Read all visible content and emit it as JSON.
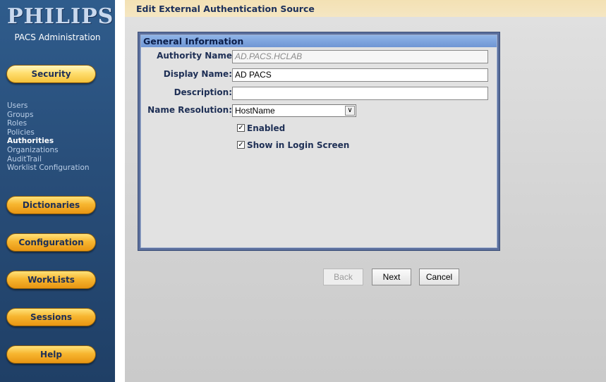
{
  "sidebar": {
    "logo": "PHILIPS",
    "app_title": "PACS Administration",
    "buttons": {
      "security": "Security",
      "dictionaries": "Dictionaries",
      "configuration": "Configuration",
      "worklists": "WorkLists",
      "sessions": "Sessions",
      "help": "Help"
    },
    "security_items": [
      "Users",
      "Groups",
      "Roles",
      "Policies",
      "Authorities",
      "Organizations",
      "AuditTrail",
      "Worklist Configuration"
    ],
    "active_item": "Authorities"
  },
  "page": {
    "title": "Edit External Authentication Source"
  },
  "form": {
    "section_title": "General Information",
    "authority_name_label": "Authority Name",
    "authority_name_value": "AD.PACS.HCLAB",
    "display_name_label": "Display Name:",
    "display_name_value": "AD PACS",
    "description_label": "Description:",
    "description_value": "",
    "name_resolution_label": "Name Resolution:",
    "name_resolution_value": "HostName",
    "enabled_label": "Enabled",
    "enabled_checked": true,
    "show_login_label": "Show in Login Screen",
    "show_login_checked": true
  },
  "actions": {
    "back": "Back",
    "next": "Next",
    "cancel": "Cancel"
  }
}
